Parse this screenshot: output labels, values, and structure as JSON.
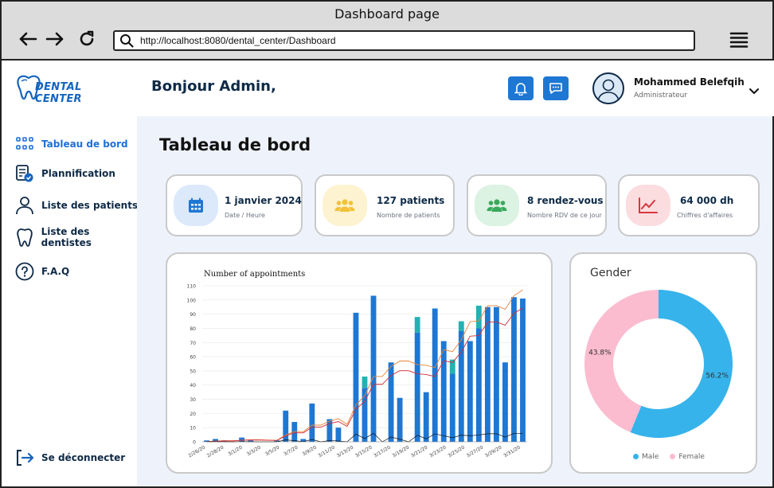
{
  "browser": {
    "window_title": "Dashboard page",
    "url": "http://localhost:8080/dental_center/Dashboard"
  },
  "logo": {
    "text": "DENTAL CENTER"
  },
  "sidebar": {
    "items": [
      {
        "label": "Tableau de bord",
        "icon": "grid-icon",
        "active": true
      },
      {
        "label": "Plannification",
        "icon": "schedule-icon",
        "active": false
      },
      {
        "label": "Liste des patients",
        "icon": "user-icon",
        "active": false
      },
      {
        "label": "Liste des dentistes",
        "icon": "tooth-icon",
        "active": false
      },
      {
        "label": "F.A.Q",
        "icon": "question-icon",
        "active": false
      }
    ],
    "logout_label": "Se déconnecter"
  },
  "header": {
    "greeting": "Bonjour Admin,",
    "user_name": "Mohammed Belefqih",
    "user_role": "Administrateur"
  },
  "main": {
    "title": "Tableau de bord",
    "cards": [
      {
        "value": "1 janvier 2024",
        "label": "Date / Heure",
        "icon": "calendar-icon",
        "color": "#1e77d3",
        "bg": "#dbe9fb"
      },
      {
        "value": "127 patients",
        "label": "Nombre de patients",
        "icon": "group-icon",
        "color": "#f3c23a",
        "bg": "#fdf3d0"
      },
      {
        "value": "8 rendez-vous",
        "label": "Nombre RDV de ce jour",
        "icon": "group-icon",
        "color": "#39a95b",
        "bg": "#dcf2e2"
      },
      {
        "value": "64 000 dh",
        "label": "Chiffres d'affaires",
        "icon": "trend-icon",
        "color": "#d9363e",
        "bg": "#fbdde0"
      }
    ]
  },
  "chart_data": [
    {
      "type": "bar",
      "title": "Number of appointments",
      "ylim": [
        0,
        110
      ],
      "yticks": [
        0,
        10,
        20,
        30,
        40,
        50,
        60,
        70,
        80,
        90,
        100,
        110
      ],
      "x_tick_labels": [
        "2/26/20",
        "2/28/20",
        "3/1/20",
        "3/3/20",
        "3/5/20",
        "3/7/20",
        "3/9/20",
        "3/11/20",
        "3/13/20",
        "3/15/20",
        "3/17/20",
        "3/19/20",
        "3/21/20",
        "3/23/20",
        "3/25/20",
        "3/27/20",
        "3/29/20",
        "3/31/20"
      ],
      "bars": [
        1,
        2,
        1,
        0,
        3,
        1,
        0,
        0,
        1,
        22,
        14,
        2,
        27,
        0,
        16,
        10,
        0,
        91,
        38,
        103,
        0,
        56,
        31,
        0,
        77,
        35,
        94,
        71,
        48,
        78,
        71,
        80,
        95,
        95,
        56,
        102,
        101
      ],
      "bars_top": [
        0,
        0,
        0,
        0,
        0,
        0,
        0,
        0,
        0,
        0,
        0,
        0,
        0,
        0,
        0,
        0,
        0,
        0,
        8,
        0,
        0,
        0,
        0,
        0,
        11,
        0,
        0,
        0,
        10,
        7,
        0,
        16,
        0,
        0,
        0,
        0,
        0
      ],
      "colors": {
        "bar": "#1e77d3",
        "bar_top": "#26b0b4",
        "line1": "#e8843a",
        "line2": "#d12b36",
        "line3": "#111111"
      }
    },
    {
      "type": "pie",
      "title": "Gender",
      "categories": [
        "Male",
        "Female"
      ],
      "values": [
        56.2,
        43.8
      ],
      "labels": [
        "56.2%",
        "43.8%"
      ],
      "colors": [
        "#36b3ea",
        "#fbbcd0"
      ]
    }
  ]
}
